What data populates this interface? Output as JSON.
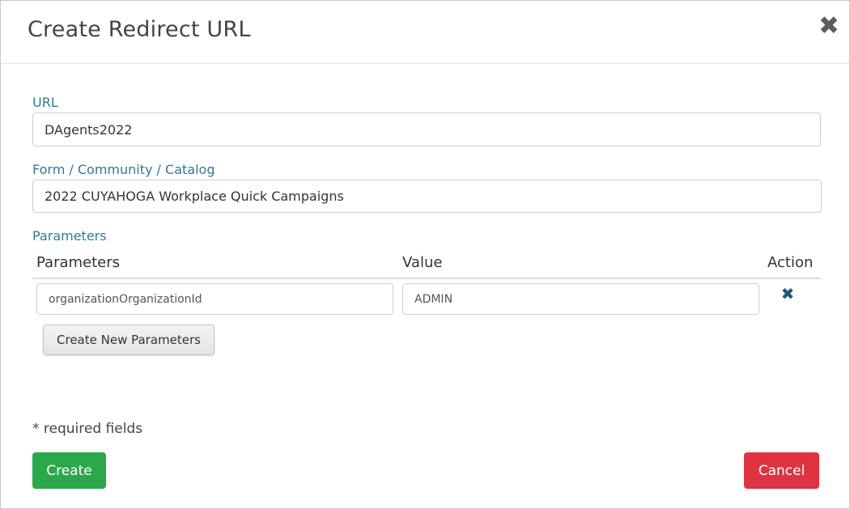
{
  "modal": {
    "title": "Create Redirect URL",
    "close_symbol": "✖",
    "close_icon": "close-icon"
  },
  "form": {
    "url": {
      "label": "URL",
      "value": "DAgents2022"
    },
    "form_community_catalog": {
      "label": "Form / Community / Catalog",
      "value": "2022 CUYAHOGA Workplace Quick Campaigns"
    },
    "parameters": {
      "label": "Parameters",
      "columns": [
        "Parameters",
        "Value",
        "Action"
      ],
      "rows": [
        {
          "parameter": "organizationOrganizationId",
          "value": "ADMIN",
          "remove_symbol": "✖",
          "remove_icon": "remove-icon"
        }
      ],
      "add_button_label": "Create New Parameters"
    },
    "required_note": "* required fields"
  },
  "actions": {
    "create_label": "Create",
    "cancel_label": "Cancel",
    "create_color": "#2ba84a",
    "cancel_color": "#dd3342"
  },
  "colors": {
    "label_accent": "#2e7a96",
    "icon_dark_teal": "#1f5a73"
  }
}
